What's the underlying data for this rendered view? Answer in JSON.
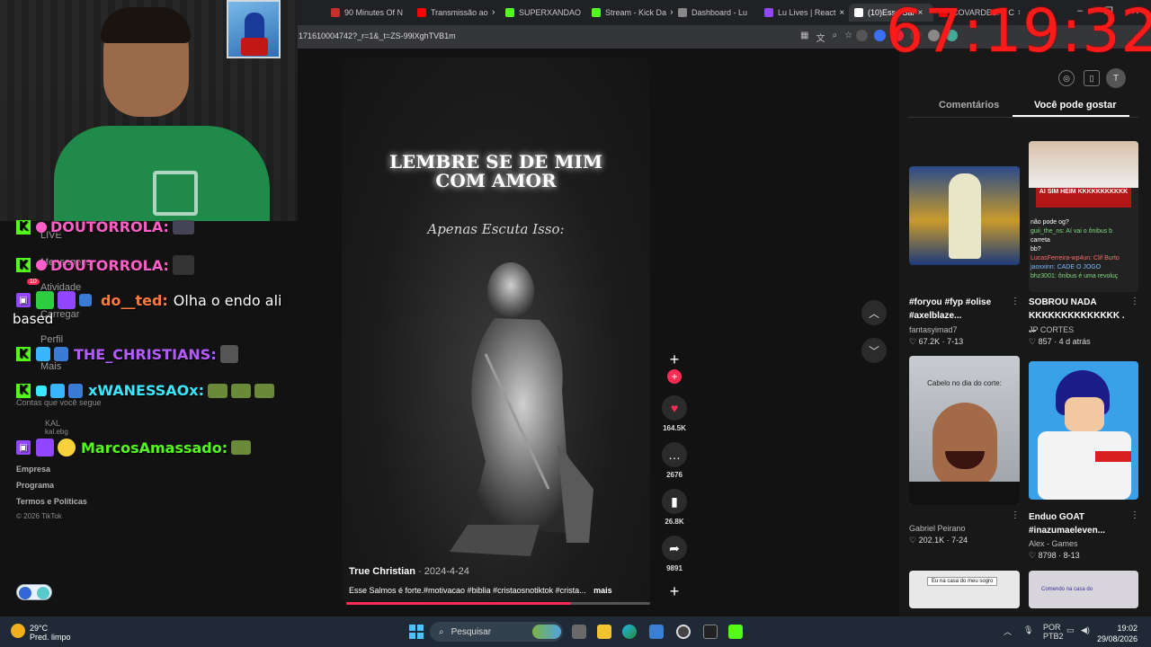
{
  "browser": {
    "tabs": [
      {
        "label": "90 Minutes Of N",
        "color": "#c4302b"
      },
      {
        "label": "Transmissão ao",
        "color": "#ff0000"
      },
      {
        "label": "SUPERXANDAO",
        "color": "#53fc18"
      },
      {
        "label": "Stream - Kick Da",
        "color": "#53fc18"
      },
      {
        "label": "Dashboard - Lu",
        "color": "#888888"
      },
      {
        "label": "Lu Lives | React",
        "color": "#9146ff"
      },
      {
        "label": "(10)Esse Sal",
        "color": "#ffffff"
      },
      {
        "label": "COVARDES! A C",
        "color": "#ff0000"
      }
    ],
    "url": "171610004742?_r=1&_t=ZS-99lXghTVB1m"
  },
  "timer": "67:19:32",
  "sidebar": {
    "items": [
      "LIVE",
      "Mensagens",
      "Atividade",
      "Carregar",
      "Perfil",
      "Mais"
    ],
    "following_title": "Contas que você segue",
    "following_user": "KAL",
    "following_handle": "kal.ebg",
    "footer_links": [
      "Empresa",
      "Programa",
      "Termos e Políticas"
    ],
    "copyright": "© 2026 TikTok",
    "badge_count": "10"
  },
  "chat": [
    {
      "user": "DOUTORROLA:",
      "color": "#ff5fc7",
      "message": "",
      "platform": "kick"
    },
    {
      "user": "DOUTORROLA:",
      "color": "#ff5fc7",
      "message": "",
      "platform": "kick"
    },
    {
      "user": "do__ted:",
      "color": "#ff7a3d",
      "message": "Olha o endo ali",
      "message2": "based",
      "platform": "twitch"
    },
    {
      "user": "THE_CHRISTIANS:",
      "color": "#b45cff",
      "message": "",
      "platform": "kick"
    },
    {
      "user": "xWANESSAOx:",
      "color": "#38e8ff",
      "message": "",
      "platform": "kick"
    },
    {
      "user": "MarcosAmassado:",
      "color": "#53fc18",
      "message": "",
      "platform": "twitch"
    }
  ],
  "video": {
    "title_line1": "LEMBRE SE DE MIM",
    "title_line2": "COM AMOR",
    "subtitle": "Apenas Escuta Isso:",
    "author": "True Christian",
    "date": "· 2024-4-24",
    "description": "Esse Salmos é forte.#motivacao #biblia #cristaosnotiktok #crista...",
    "more": "mais",
    "progress": 0.74
  },
  "actions": {
    "likes": "164.5K",
    "comments": "2676",
    "saves": "26.8K",
    "shares": "9891"
  },
  "rightpanel": {
    "tab_comments": "Comentários",
    "tab_suggest": "Você pode gostar",
    "cards": [
      {
        "title": "#foryou #fyp #olise #axelblaze...",
        "author": "fantasyimad7",
        "stats": "♡ 67.2K · 7-13"
      },
      {
        "title": "SOBROU NADA KKKKKKKKKKKKKK . ...",
        "author": "JP CORTES",
        "stats": "♡ 857 · 4 d atrás",
        "overlay": "AI SIM HEIM KKKKKKKKKKK"
      },
      {
        "title": "",
        "author": "Gabriel Peirano",
        "stats": "♡ 202.1K · 7-24",
        "overlay": "Cabelo no dia do corte:"
      },
      {
        "title": "Enduo GOAT #inazumaeleven...",
        "author": "Alex - Games",
        "stats": "♡ 8798 · 8-13"
      },
      {
        "overlay": "Eu na casa do meu sogro"
      },
      {
        "overlay": "Comendo na casa do"
      }
    ],
    "chat_snippets": [
      "não pode og?",
      "guii_the_ns: Aí vai o ônibus b",
      "carreta",
      "bb?",
      "LucasFerreira-wp4un: Clif Burto",
      "jaoxxinn: CADE O JOGO",
      "bhz3001: ônibus é uma revoluç"
    ]
  },
  "taskbar": {
    "weather_temp": "29°C",
    "weather_desc": "Pred. limpo",
    "search_label": "Pesquisar",
    "lang1": "POR",
    "lang2": "PTB2",
    "time": "19:02",
    "date": "29/08/2026"
  }
}
